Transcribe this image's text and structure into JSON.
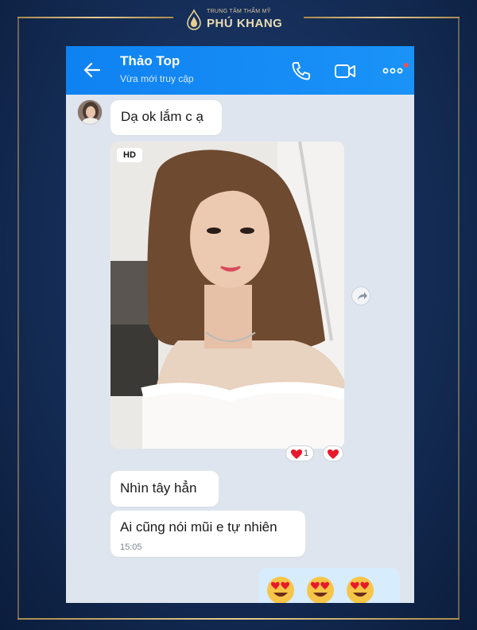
{
  "brand": {
    "tagline": "TRUNG TÂM THẨM MỸ",
    "name": "PHÚ KHANG"
  },
  "chat_header": {
    "contact_name": "Thảo Top",
    "status": "Vừa mới truy cập",
    "icons": [
      "back-arrow-icon",
      "phone-call-icon",
      "video-call-icon",
      "more-options-icon"
    ]
  },
  "messages": [
    {
      "type": "text",
      "text": "Dạ ok lắm c ạ"
    },
    {
      "type": "photo",
      "badge": "HD",
      "reactions": [
        {
          "icon": "heart-icon",
          "count": "1"
        },
        {
          "icon": "heart-icon"
        }
      ]
    },
    {
      "type": "text",
      "text": "Nhìn tây hẳn"
    },
    {
      "type": "text",
      "text": "Ai cũng nói mũi e tự nhiên",
      "time": "15:05"
    },
    {
      "type": "sent",
      "content": [
        "heart-eyes-emoji",
        "heart-eyes-emoji",
        "heart-eyes-emoji"
      ]
    }
  ],
  "colors": {
    "header_blue": "#0f82f1",
    "chat_background": "#dfe5ee",
    "frame_navy": "#142c55",
    "gold": "#d8bf84",
    "heart_red": "#e8192c",
    "sent_bubble": "#d7ecfc"
  }
}
